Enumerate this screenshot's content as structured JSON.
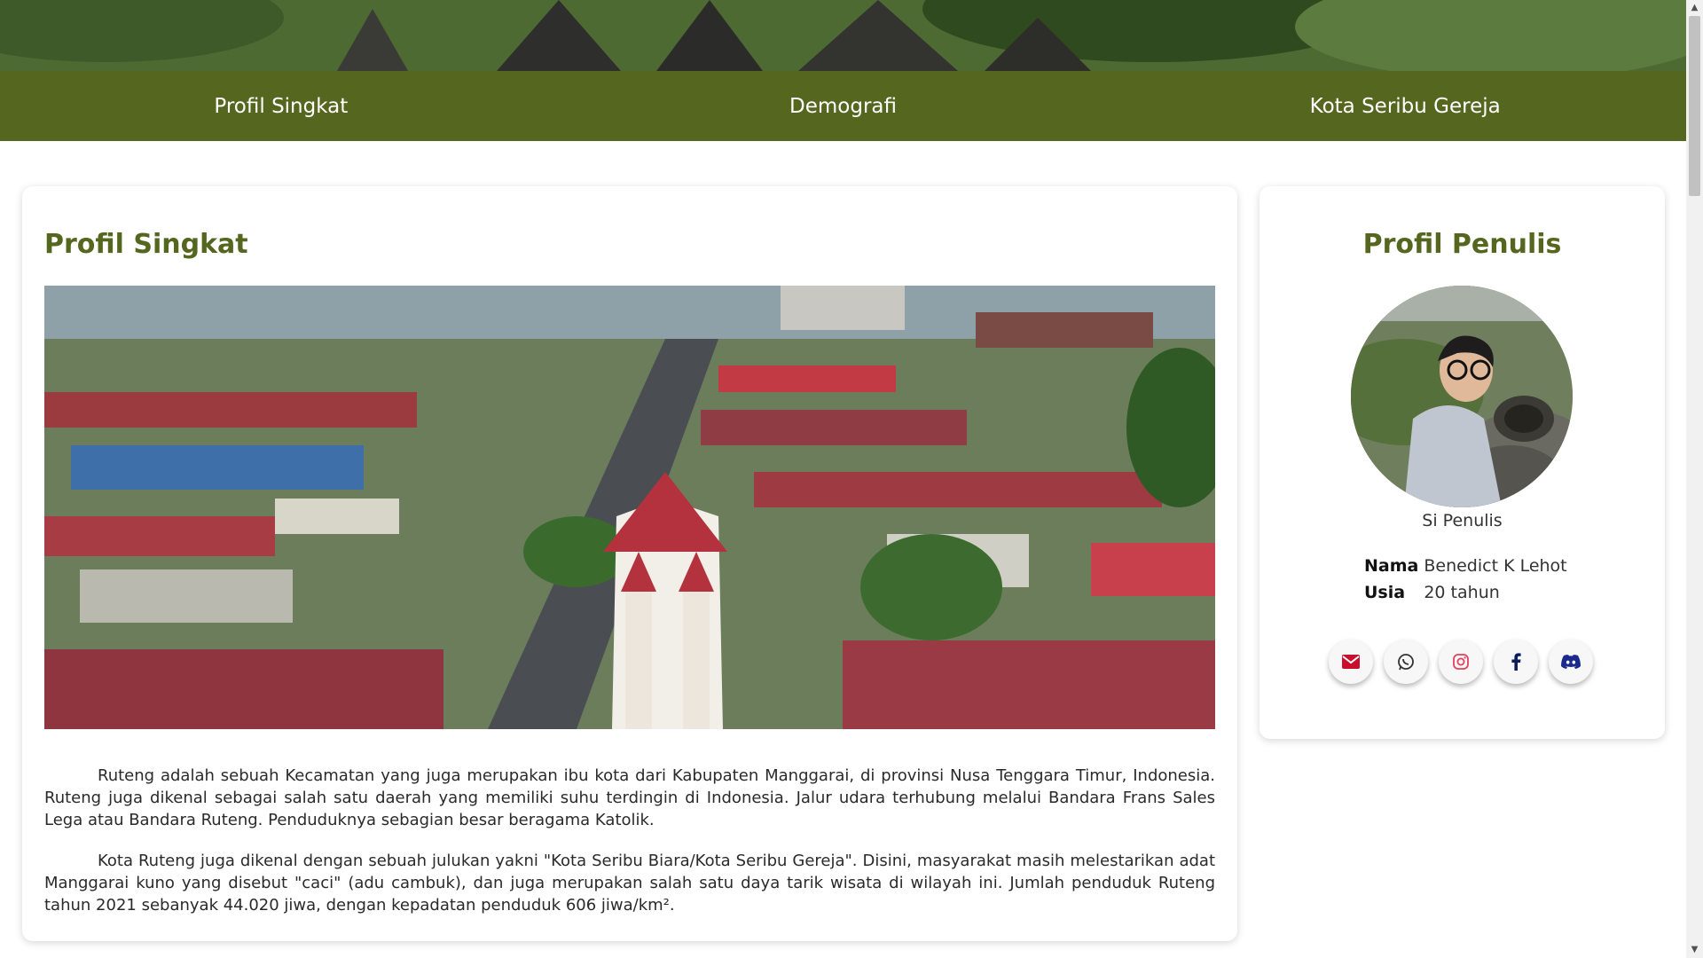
{
  "nav": {
    "items": [
      {
        "label": "Profil Singkat"
      },
      {
        "label": "Demografi"
      },
      {
        "label": "Kota Seribu Gereja"
      }
    ]
  },
  "main": {
    "title": "Profil Singkat",
    "image": "aerial-photo-of-ruteng-town-with-church",
    "paragraphs": [
      "Ruteng adalah sebuah Kecamatan yang juga merupakan ibu kota dari Kabupaten Manggarai, di provinsi Nusa Tenggara Timur, Indonesia. Ruteng juga dikenal sebagai salah satu daerah yang memiliki suhu terdingin di Indonesia. Jalur udara terhubung melalui Bandara Frans Sales Lega atau Bandara Ruteng. Penduduknya sebagian besar beragama Katolik.",
      "Kota Ruteng juga dikenal dengan sebuah julukan yakni \"Kota Seribu Biara/Kota Seribu Gereja\". Disini, masyarakat masih melestarikan adat Manggarai kuno yang disebut \"caci\" (adu cambuk), dan juga merupakan salah satu daya tarik wisata di wilayah ini. Jumlah penduduk Ruteng tahun 2021 sebanyak 44.020 jiwa, dengan kepadatan penduduk 606 jiwa/km²."
    ]
  },
  "sidebar": {
    "title": "Profil Penulis",
    "caption": "Si Penulis",
    "info": [
      {
        "key": "Nama",
        "value": "Benedict K Lehot"
      },
      {
        "key": "Usia",
        "value": "20 tahun"
      }
    ],
    "socials": [
      {
        "icon": "email-icon",
        "color": "#c8102e"
      },
      {
        "icon": "whatsapp-icon",
        "color": "#333333"
      },
      {
        "icon": "instagram-icon",
        "color": "#e4405f"
      },
      {
        "icon": "facebook-icon",
        "color": "#0b1d5c"
      },
      {
        "icon": "discord-icon",
        "color": "#1a2a8c"
      }
    ]
  },
  "colors": {
    "brand_green": "#55661f",
    "background": "#ffffff"
  }
}
